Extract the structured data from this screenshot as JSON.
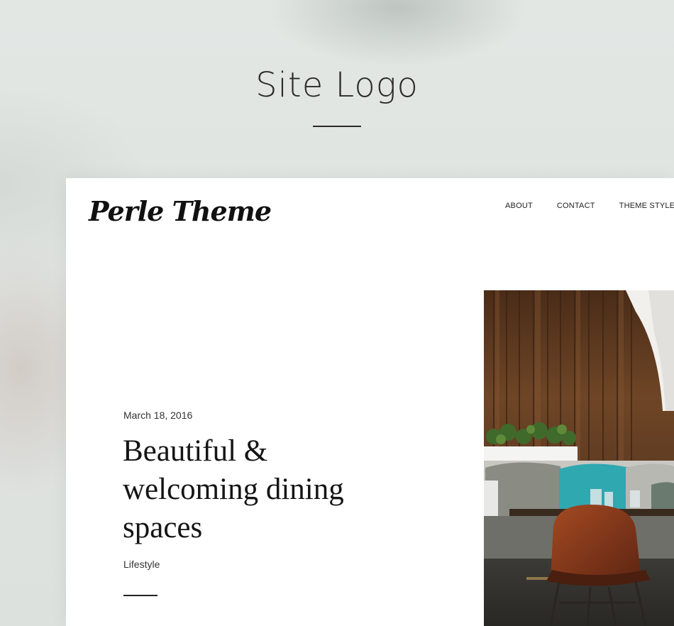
{
  "section": {
    "title": "Site Logo"
  },
  "site": {
    "logo": "Perle Theme"
  },
  "nav": {
    "items": [
      {
        "label": "ABOUT"
      },
      {
        "label": "CONTACT"
      },
      {
        "label": "THEME STYLES",
        "has_dropdown": true
      }
    ]
  },
  "post": {
    "date": "March 18, 2016",
    "title": "Beautiful & welcoming dining spaces",
    "category": "Lifestyle"
  },
  "colors": {
    "text": "#222222",
    "accent_teal": "#2fa8b0",
    "wood": "#6b4326",
    "chair": "#8a3b1c"
  },
  "icons": {
    "dropdown": "chevron-down-icon"
  }
}
